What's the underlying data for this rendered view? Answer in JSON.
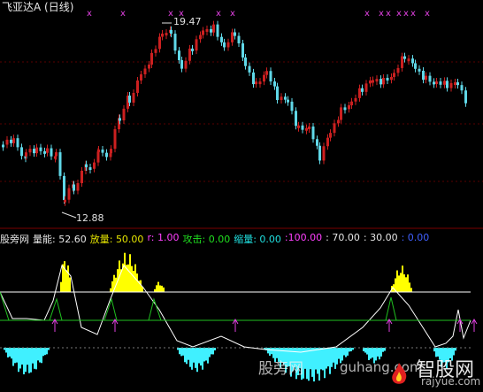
{
  "price_panel": {
    "title": "飞亚达A (日线)",
    "high_marker": "19.47",
    "low_marker": "12.88"
  },
  "indicator_panel": {
    "name": "股旁网",
    "values": [
      {
        "label": "量能:",
        "value": "52.60",
        "color": "#e6e6e6"
      },
      {
        "label": "放量:",
        "value": "50.00",
        "color": "#e6e600"
      },
      {
        "label": "r:",
        "value": "1.00",
        "color": "#ff40ff"
      },
      {
        "label": "攻击:",
        "value": "0.00",
        "color": "#20e020"
      },
      {
        "label": "缩量:",
        "value": "0.00",
        "color": "#20e0e0"
      },
      {
        "label": ":",
        "value": "100.00",
        "color": "#ff40ff"
      },
      {
        "label": ":",
        "value": "70.00",
        "color": "#e6e6e6"
      },
      {
        "label": ":",
        "value": "30.00",
        "color": "#e6e6e6"
      },
      {
        "label": ":",
        "value": "0.00",
        "color": "#4060ff"
      }
    ]
  },
  "watermarks": {
    "left": "股旁网",
    "right": "guhang.com",
    "logo": "智股网",
    "logo_url": "rajyue.com"
  },
  "colors": {
    "background": "#000000",
    "candle_up": "#cc2020",
    "candle_down": "#60d8e8",
    "marker": "#e040e0",
    "volume_bar": "#ffff00",
    "shrink_bar": "#40f0ff",
    "line_white": "#ffffff",
    "line_green": "#20c020"
  }
}
